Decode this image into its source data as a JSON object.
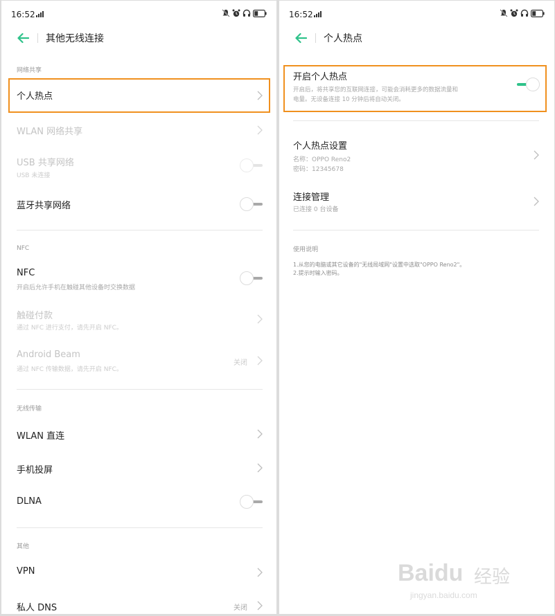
{
  "status_bar": {
    "time": "16:52"
  },
  "left": {
    "title": "其他无线连接",
    "sections": {
      "tethering": "网络共享",
      "nfc": "NFC",
      "casting": "无线传输",
      "other": "其他"
    },
    "items": {
      "hotspot": {
        "title": "个人热点"
      },
      "wlan_share": {
        "title": "WLAN 网络共享"
      },
      "usb_share": {
        "title": "USB 共享网络",
        "sub": "USB 未连接"
      },
      "bt_share": {
        "title": "蓝牙共享网络"
      },
      "nfc": {
        "title": "NFC",
        "sub": "开启后允许手机在触碰其他设备时交换数据"
      },
      "tap_pay": {
        "title": "触碰付款",
        "sub": "通过 NFC 进行支付，请先开启 NFC。"
      },
      "android_beam": {
        "title": "Android Beam",
        "sub": "通过 NFC 传输数据，请先开启 NFC。",
        "value": "关闭"
      },
      "wlan_direct": {
        "title": "WLAN 直连"
      },
      "screen_cast": {
        "title": "手机投屏"
      },
      "dlna": {
        "title": "DLNA"
      },
      "vpn": {
        "title": "VPN"
      },
      "private_dns": {
        "title": "私人 DNS",
        "value": "关闭"
      }
    }
  },
  "right": {
    "title": "个人热点",
    "hotspot_toggle": {
      "title": "开启个人热点",
      "sub_line1": "开启后，将共享您的互联网连接，可能会消耗更多的数据流量和",
      "sub_line2": "电量。无设备连接 10 分钟后将自动关闭。",
      "state": "on"
    },
    "settings": {
      "title": "个人热点设置",
      "name_line": "名称：OPPO Reno2",
      "password_line": "密码：12345678"
    },
    "manage": {
      "title": "连接管理",
      "sub": "已连接 0 台设备"
    },
    "usage": {
      "header": "使用说明",
      "line1": "1.从您的电脑或其它设备的\"无线局域网\"设置中选取\"OPPO Reno2\"。",
      "line2": "2.提示时输入密码。"
    }
  },
  "watermark": {
    "brand": "Baidu",
    "brand_cn": "经验",
    "url": "jingyan.baidu.com"
  },
  "colors": {
    "accent": "#2fc28a",
    "highlight": "#f0901e"
  }
}
